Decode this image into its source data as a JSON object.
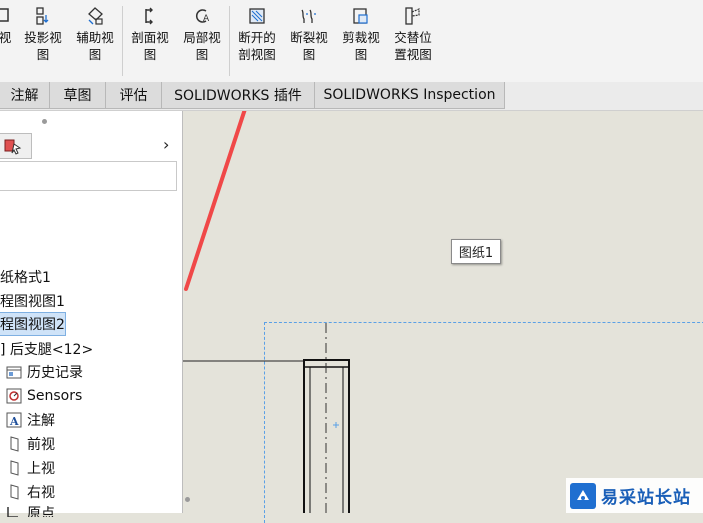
{
  "ribbon": {
    "buttons": [
      {
        "id": "partial",
        "line1": "视",
        "line2": ""
      },
      {
        "id": "projected",
        "line1": "投影视",
        "line2": "图"
      },
      {
        "id": "auxiliary",
        "line1": "辅助视",
        "line2": "图"
      },
      {
        "id": "section",
        "line1": "剖面视",
        "line2": "图"
      },
      {
        "id": "detail",
        "line1": "局部视",
        "line2": "图"
      },
      {
        "id": "broken-out",
        "line1": "断开的",
        "line2": "剖视图"
      },
      {
        "id": "break",
        "line1": "断裂视",
        "line2": "图"
      },
      {
        "id": "crop",
        "line1": "剪裁视",
        "line2": "图"
      },
      {
        "id": "alternate",
        "line1": "交替位",
        "line2": "置视图"
      }
    ]
  },
  "tabs": [
    {
      "label": "注解"
    },
    {
      "label": "草图"
    },
    {
      "label": "评估"
    },
    {
      "label": "SOLIDWORKS 插件"
    },
    {
      "label": "SOLIDWORKS Inspection"
    }
  ],
  "tree": {
    "items": [
      {
        "label": "纸格式1",
        "icon": "none"
      },
      {
        "label": "程图视图1",
        "icon": "none"
      },
      {
        "label": "程图视图2",
        "icon": "none",
        "selected": true
      },
      {
        "label": "] 后支腿<12>",
        "icon": "none"
      },
      {
        "label": "历史记录",
        "icon": "history-icon"
      },
      {
        "label": "Sensors",
        "icon": "sensor-icon"
      },
      {
        "label": "注解",
        "icon": "annotation-icon"
      },
      {
        "label": "前视",
        "icon": "plane-icon"
      },
      {
        "label": "上视",
        "icon": "plane-icon"
      },
      {
        "label": "右视",
        "icon": "plane-icon"
      },
      {
        "label": "原点",
        "icon": "origin-icon"
      }
    ]
  },
  "canvas": {
    "sheet_label": "图纸1"
  },
  "watermark": {
    "text": "易采站长站"
  },
  "colors": {
    "annotation_arrow": "#f04848",
    "sheet_border": "#5aa0e6",
    "selection": "#cfe3f8"
  }
}
